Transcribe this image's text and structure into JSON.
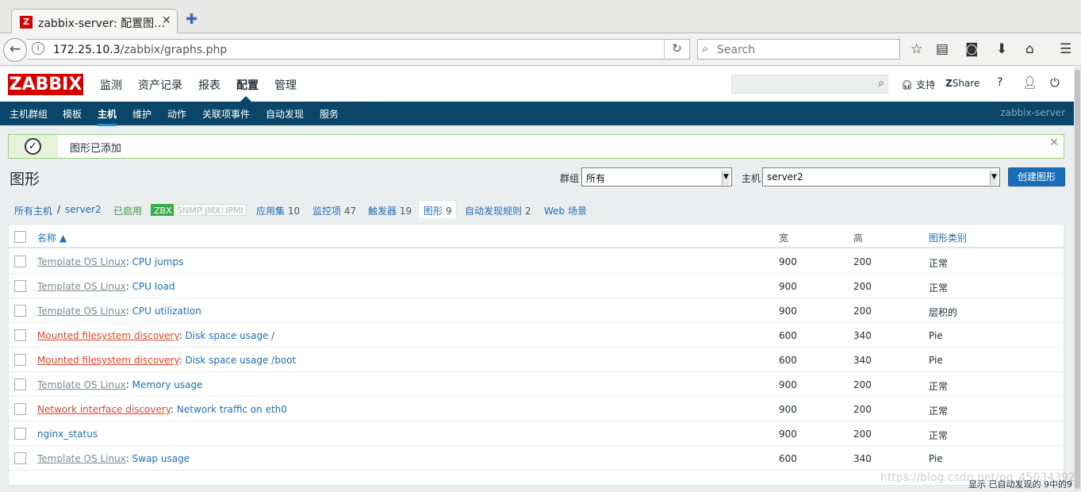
{
  "browser": {
    "tab_title": "zabbix-server: 配置图…",
    "tab_favicon": "Z",
    "url_host": "172.25.10.3",
    "url_path": "/zabbix/graphs.php",
    "search_placeholder": "Search"
  },
  "header": {
    "logo": "ZABBIX",
    "menu": [
      "监测",
      "资产记录",
      "报表",
      "配置",
      "管理"
    ],
    "active_menu": "配置",
    "support": "支持",
    "share": "Share",
    "help": "?",
    "colors": {
      "logo": "#d40000",
      "submenu_bg": "#0a466a",
      "link": "#1f6fb4",
      "discovery": "#e0452b"
    }
  },
  "submenu": {
    "items": [
      "主机群组",
      "模板",
      "主机",
      "维护",
      "动作",
      "关联项事件",
      "自动发现",
      "服务"
    ],
    "active": "主机",
    "server_name": "zabbix-server"
  },
  "message": {
    "text": "图形已添加"
  },
  "page": {
    "title": "图形",
    "group_label": "群组",
    "group_value": "所有",
    "host_label": "主机",
    "host_value": "server2",
    "create_button": "创建图形"
  },
  "host_nav": {
    "all_hosts": "所有主机",
    "separator": "/",
    "host": "server2",
    "enabled": "已启用",
    "badges": [
      "ZBX",
      "SNMP",
      "JMX",
      "IPMI"
    ],
    "apps_label": "应用集",
    "apps_count": "10",
    "items_label": "监控项",
    "items_count": "47",
    "triggers_label": "触发器",
    "triggers_count": "19",
    "graphs_label": "图形",
    "graphs_count": "9",
    "discovery_label": "自动发现规则",
    "discovery_count": "2",
    "web_label": "Web 场景"
  },
  "table": {
    "headers": {
      "name": "名称 ▲",
      "width": "宽",
      "height": "高",
      "type": "图形类别"
    },
    "rows": [
      {
        "prefix": "Template OS Linux",
        "name": "CPU jumps",
        "width": "900",
        "height": "200",
        "type": "正常"
      },
      {
        "prefix": "Template OS Linux",
        "name": "CPU load",
        "width": "900",
        "height": "200",
        "type": "正常"
      },
      {
        "prefix": "Template OS Linux",
        "name": "CPU utilization",
        "width": "900",
        "height": "200",
        "type": "层积的"
      },
      {
        "prefix": "Mounted filesystem discovery",
        "name": "Disk space usage /",
        "width": "600",
        "height": "340",
        "type": "Pie"
      },
      {
        "prefix": "Mounted filesystem discovery",
        "name": "Disk space usage /boot",
        "width": "600",
        "height": "340",
        "type": "Pie"
      },
      {
        "prefix": "Template OS Linux",
        "name": "Memory usage",
        "width": "900",
        "height": "200",
        "type": "正常"
      },
      {
        "prefix": "Network interface discovery",
        "name": "Network traffic on eth0",
        "width": "900",
        "height": "200",
        "type": "正常"
      },
      {
        "prefix": "",
        "name": "nginx_status",
        "width": "900",
        "height": "200",
        "type": "正常"
      },
      {
        "prefix": "Template OS Linux",
        "name": "Swap usage",
        "width": "600",
        "height": "340",
        "type": "Pie"
      }
    ],
    "footer": "显示 已自动发现的 9中的9"
  },
  "watermark": "https://blog.csdn.net/qq_45034392"
}
